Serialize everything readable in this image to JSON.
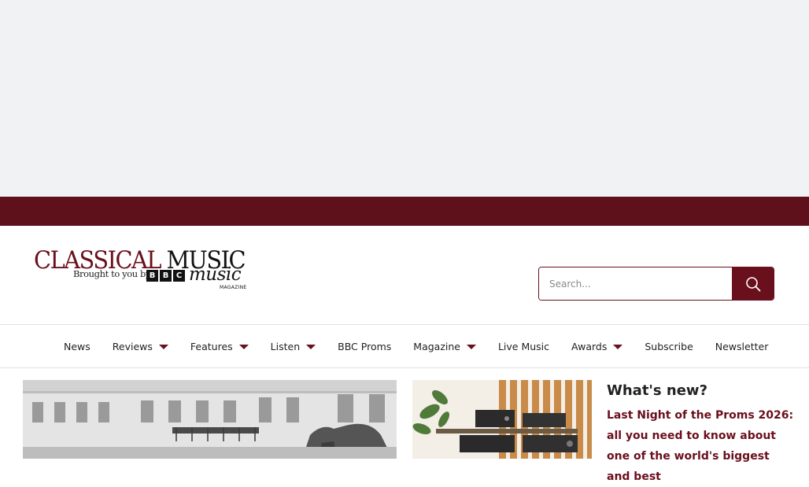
{
  "header": {
    "logo": {
      "word_classical": "CLASSICAL",
      "word_music": "MUSIC",
      "tagline": "Brought to you by",
      "bbc_letters": [
        "B",
        "B",
        "C"
      ],
      "music_word": "music",
      "magazine_word": "MAGAZINE"
    },
    "search": {
      "placeholder": "Search...",
      "value": "",
      "button_icon": "search-icon"
    }
  },
  "nav": {
    "items": [
      {
        "label": "News",
        "has_dropdown": false
      },
      {
        "label": "Reviews",
        "has_dropdown": true
      },
      {
        "label": "Features",
        "has_dropdown": true
      },
      {
        "label": "Listen",
        "has_dropdown": true
      },
      {
        "label": "BBC Proms",
        "has_dropdown": false
      },
      {
        "label": "Magazine",
        "has_dropdown": true
      },
      {
        "label": "Live Music",
        "has_dropdown": false
      },
      {
        "label": "Awards",
        "has_dropdown": true
      },
      {
        "label": "Subscribe",
        "has_dropdown": false
      },
      {
        "label": "Newsletter",
        "has_dropdown": false
      }
    ]
  },
  "main": {
    "whats_new_heading": "What's new?",
    "featured_headline": "Last Night of the Proms 2026: all you need to know about one of the world's biggest and best"
  },
  "colors": {
    "brand": "#6a0f1c",
    "top_band": "#5e101b",
    "ad_background": "#f1f2f4"
  }
}
